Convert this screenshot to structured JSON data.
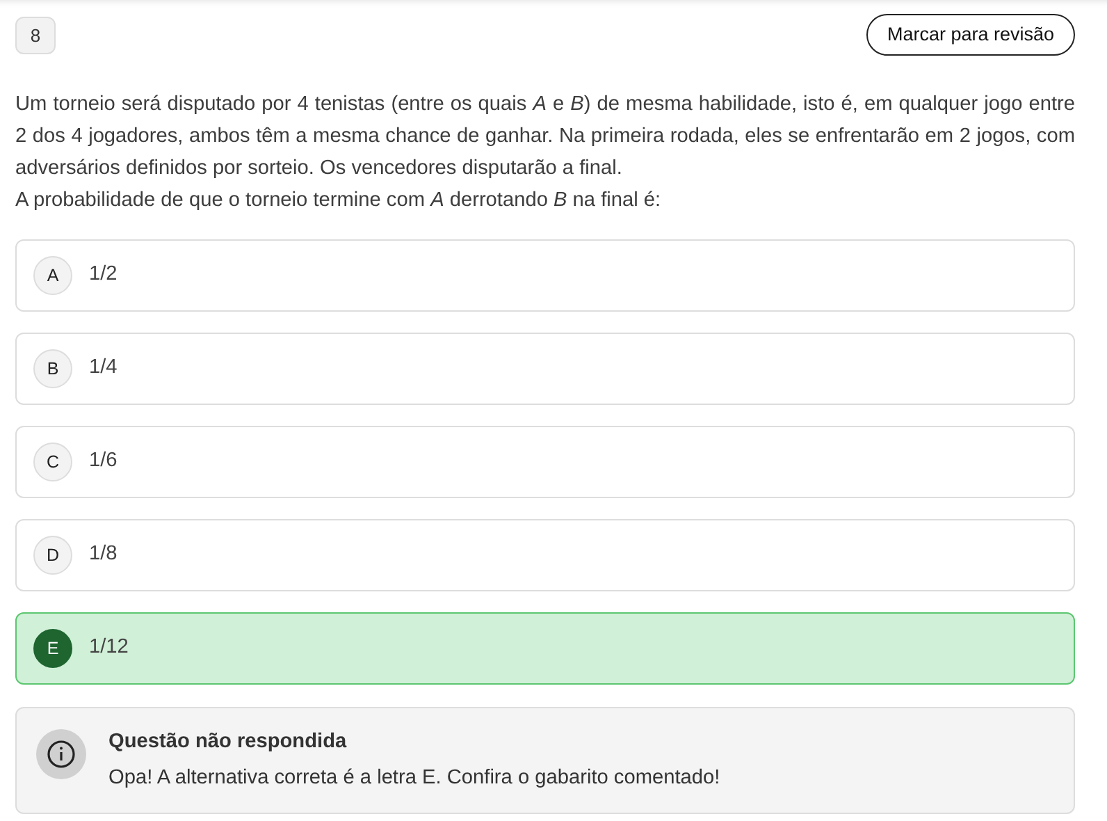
{
  "question_number": "8",
  "review_button": "Marcar para revisão",
  "statement": [
    "Um torneio será disputado por 4 tenistas (entre os quais *A* e *B*) de mesma habilidade, isto é, em qualquer jogo entre 2 dos 4 jogadores, ambos têm a mesma chance de ganhar. Na primeira rodada, eles se enfrentarão em 2 jogos, com adversários definidos por sorteio. Os vencedores disputarão a final.",
    "A probabilidade de que o torneio termine com *A* derrotando *B* na final é:"
  ],
  "options": [
    {
      "letter": "A",
      "text": "1/2",
      "correct": false
    },
    {
      "letter": "B",
      "text": "1/4",
      "correct": false
    },
    {
      "letter": "C",
      "text": "1/6",
      "correct": false
    },
    {
      "letter": "D",
      "text": "1/8",
      "correct": false
    },
    {
      "letter": "E",
      "text": "1/12",
      "correct": true
    }
  ],
  "feedback": {
    "title": "Questão não respondida",
    "message": "Opa! A alternativa correta é a letra E. Confira o gabarito comentado!"
  }
}
